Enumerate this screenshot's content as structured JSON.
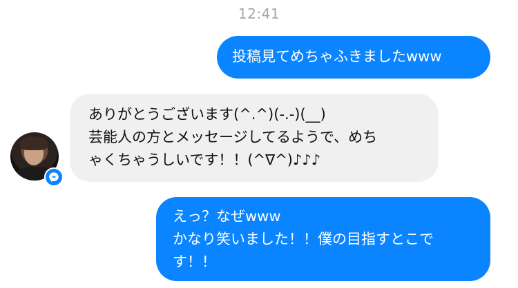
{
  "chat": {
    "timestamp": "12:41",
    "messages": [
      {
        "sender": "me",
        "lines": [
          "投稿見てめちゃふきましたwww"
        ]
      },
      {
        "sender": "other",
        "lines": [
          "ありがとうございます(^.^)(-.-)(__)",
          "芸能人の方とメッセージしてるようで、めち",
          "ゃくちゃうしいです！！(^∇^)♪♪♪"
        ]
      },
      {
        "sender": "me",
        "lines": [
          "えっ？なぜwww",
          "かなり笑いました！！僕の目指すとこで",
          "す！！"
        ]
      }
    ]
  },
  "icons": {
    "avatar": "contact-avatar",
    "badge": "messenger-icon"
  },
  "colors": {
    "outgoing_bubble": "#0a84ff",
    "incoming_bubble": "#f0f0f0",
    "timestamp": "#a6a6a6"
  }
}
